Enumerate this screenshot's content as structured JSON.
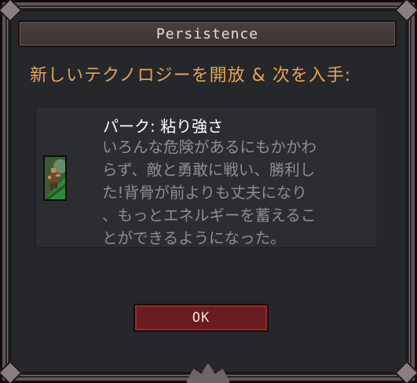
{
  "dialog": {
    "title": "Persistence",
    "headline": "新しいテクノロジーを開放 & 次を入手:",
    "perk": {
      "title": "パーク: 粘り強さ",
      "description": "いろんな危険があるにもかかわ\nらず、敵と勇敢に戦い、勝利し\nた!背骨が前よりも丈夫になり\n、もっとエネルギーを蓄えるこ\nとができるようになった。",
      "icon": "climbing-figure-icon"
    },
    "ok_label": "OK"
  },
  "colors": {
    "headline": "#e3a35a",
    "button": "#6b1c1e",
    "panel": "#26272b"
  }
}
